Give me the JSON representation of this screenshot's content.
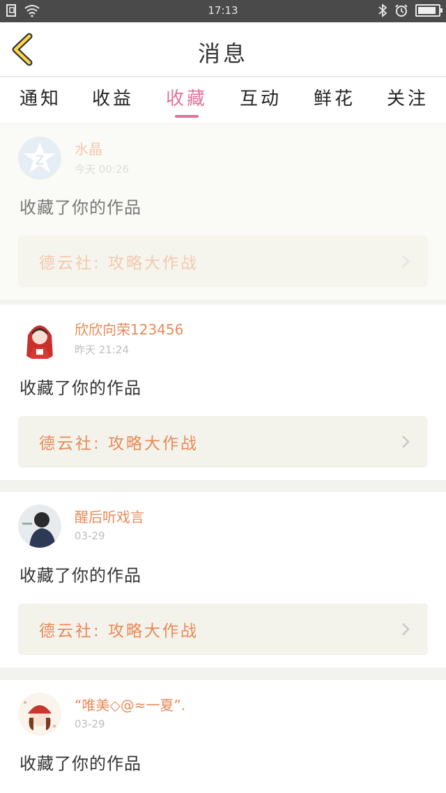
{
  "status_bar": {
    "time": "17:13",
    "battery_level": 0.9
  },
  "header": {
    "title": "消息"
  },
  "tabs": [
    {
      "label": "通知",
      "active": false
    },
    {
      "label": "收益",
      "active": false
    },
    {
      "label": "收藏",
      "active": true
    },
    {
      "label": "互动",
      "active": false
    },
    {
      "label": "鲜花",
      "active": false
    },
    {
      "label": "关注",
      "active": false
    }
  ],
  "accent_color": "#e2719b",
  "name_color": "#e88a58",
  "messages": [
    {
      "user": "水晶",
      "time": "今天 00:26",
      "action": "收藏了你的作品",
      "work_title": "德云社: 攻略大作战"
    },
    {
      "user": "欣欣向荣123456",
      "time": "昨天 21:24",
      "action": "收藏了你的作品",
      "work_title": "德云社: 攻略大作战"
    },
    {
      "user": "醒后听戏言",
      "time": "03-29",
      "action": "收藏了你的作品",
      "work_title": "德云社: 攻略大作战"
    },
    {
      "user": "“唯美◇@≈一夏”.",
      "time": "03-29",
      "action": "收藏了你的作品"
    }
  ]
}
